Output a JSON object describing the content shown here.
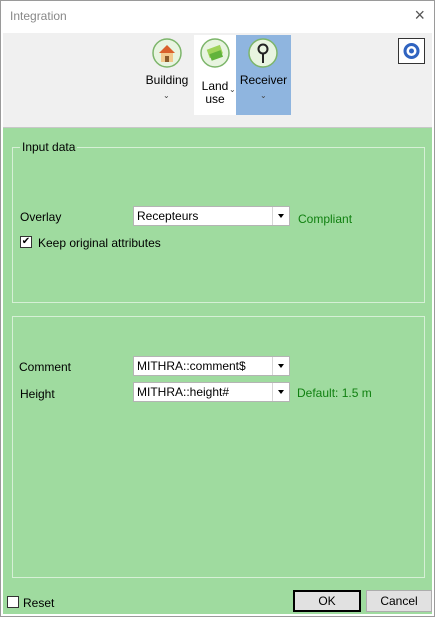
{
  "window": {
    "title": "Integration",
    "close_icon": "×"
  },
  "toolbar": {
    "building": {
      "label": "Building"
    },
    "land_use": {
      "label_line1": "Land",
      "label_line2": "use"
    },
    "receiver": {
      "label": "Receiver"
    },
    "dropdown_glyph": "⌄",
    "settings_icon": "gear"
  },
  "input_data": {
    "group_label": "Input data",
    "overlay": {
      "label": "Overlay",
      "value": "Recepteurs",
      "status": "Compliant"
    },
    "keep_attributes": {
      "label": "Keep original attributes",
      "checked": true,
      "mark": "✔"
    }
  },
  "fields": {
    "comment": {
      "label": "Comment",
      "value": "MITHRA::comment$"
    },
    "height": {
      "label": "Height",
      "value": "MITHRA::height#",
      "default": "Default: 1.5 m"
    }
  },
  "footer": {
    "reset_label": "Reset",
    "ok_label": "OK",
    "cancel_label": "Cancel"
  }
}
